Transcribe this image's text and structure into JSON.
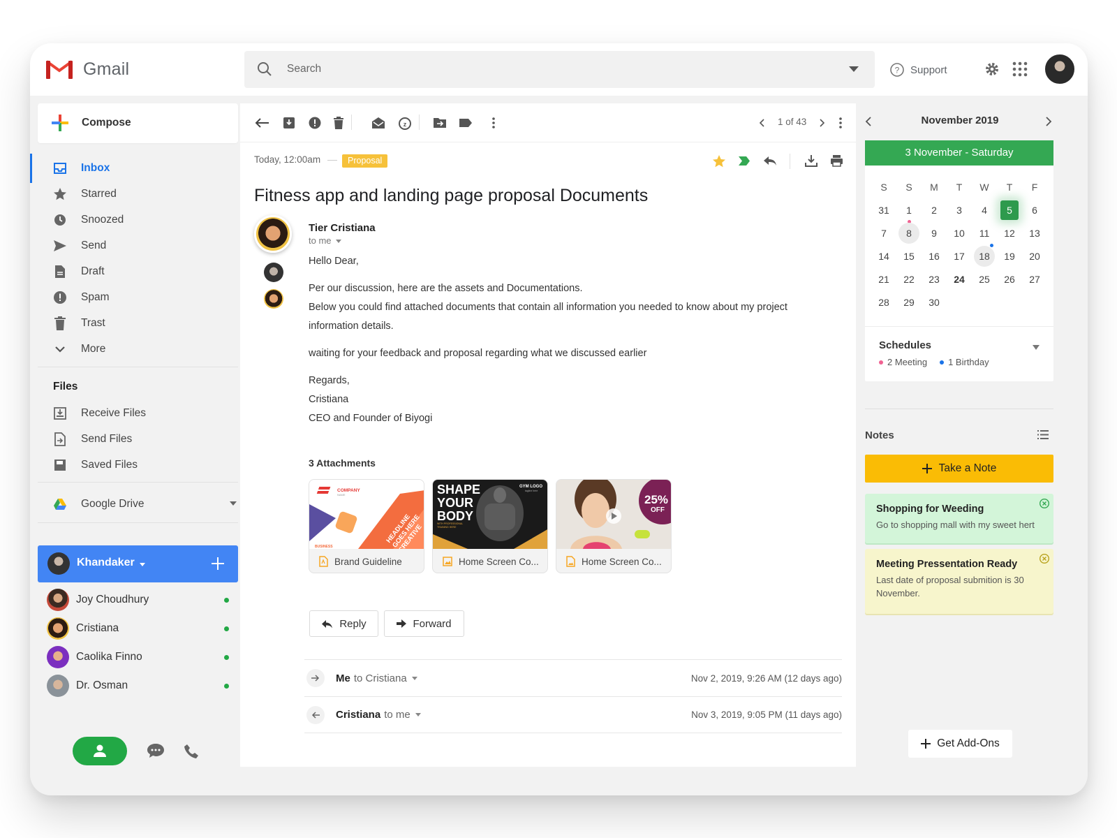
{
  "app": {
    "title": "Gmail"
  },
  "header": {
    "search_placeholder": "Search",
    "support_label": "Support"
  },
  "sidebar": {
    "compose_label": "Compose",
    "nav": [
      {
        "label": "Inbox",
        "icon": "inbox-icon",
        "active": true
      },
      {
        "label": "Starred",
        "icon": "star-icon"
      },
      {
        "label": "Snoozed",
        "icon": "clock-icon"
      },
      {
        "label": "Send",
        "icon": "send-icon"
      },
      {
        "label": "Draft",
        "icon": "draft-icon"
      },
      {
        "label": "Spam",
        "icon": "spam-icon"
      },
      {
        "label": "Trast",
        "icon": "trash-icon"
      },
      {
        "label": "More",
        "icon": "chevron-down-icon"
      }
    ],
    "files_title": "Files",
    "files": [
      {
        "label": "Receive Files",
        "icon": "receive-files-icon"
      },
      {
        "label": "Send Files",
        "icon": "send-files-icon"
      },
      {
        "label": "Saved Files",
        "icon": "saved-files-icon"
      }
    ],
    "drive_label": "Google Drive",
    "account_name": "Khandaker",
    "contacts": [
      {
        "name": "Joy Choudhury",
        "online": true
      },
      {
        "name": "Cristiana",
        "online": true
      },
      {
        "name": "Caolika Finno",
        "online": true
      },
      {
        "name": "Dr. Osman",
        "online": true
      }
    ]
  },
  "email": {
    "pager": "1 of 43",
    "date": "Today, 12:00am",
    "tag": "Proposal",
    "subject": "Fitness app and landing page proposal Documents",
    "sender": "Tier Cristiana",
    "to": "to me",
    "body": [
      "Hello Dear,",
      "Per our discussion, here are the assets and Documentations.",
      "Below you could find attached documents that contain all information you needed to know about my project",
      "information details.",
      "waiting for your feedback and proposal regarding what we discussed earlier",
      "Regards,",
      "Cristiana",
      "CEO and Founder of Biyogi"
    ],
    "attachments_title": "3 Attachments",
    "attachments": [
      {
        "name": "Brand Guideline",
        "type": "pdf",
        "thumb": {
          "t1": "COMPANY",
          "t2": "NAME",
          "t3": "BUSINESS",
          "t4": "HEADLINE",
          "t5": "GOES HERE",
          "t6": "CREATIVE"
        }
      },
      {
        "name": "Home Screen Co...",
        "type": "image",
        "thumb": {
          "l1": "SHAPE",
          "l2": "YOUR",
          "l3": "BODY",
          "logo": "GYM LOGO",
          "tagline": "tagline here",
          "sub1": "WITH PROFESSIONAL",
          "sub2": "TRAINING HERE"
        }
      },
      {
        "name": "Home Screen Co...",
        "type": "image",
        "thumb": {
          "pct": "25%",
          "off": "OFF"
        }
      }
    ],
    "reply_label": "Reply",
    "forward_label": "Forward",
    "thread": [
      {
        "who": "Me",
        "to": "to Cristiana",
        "when": "Nov 2, 2019, 9:26 AM (12 days ago)",
        "direction": "out"
      },
      {
        "who": "Cristiana",
        "to": "to me",
        "when": "Nov 3, 2019, 9:05 PM (11 days ago)",
        "direction": "in"
      }
    ]
  },
  "calendar": {
    "month": "November 2019",
    "selected": "3 November - Saturday",
    "dow": [
      "S",
      "S",
      "M",
      "T",
      "W",
      "T",
      "F"
    ],
    "weeks": [
      [
        "31",
        "1",
        "2",
        "3",
        "4",
        "5",
        "6"
      ],
      [
        "7",
        "8",
        "9",
        "10",
        "11",
        "12",
        "13"
      ],
      [
        "14",
        "15",
        "16",
        "17",
        "18",
        "19",
        "20"
      ],
      [
        "21",
        "22",
        "23",
        "24",
        "25",
        "26",
        "27"
      ],
      [
        "28",
        "29",
        "30"
      ]
    ],
    "highlight": "5",
    "schedules_title": "Schedules",
    "meetings": "2 Meeting",
    "birthdays": "1 Birthday",
    "colors": {
      "green": "#34a853",
      "meeting_dot": "#f06292",
      "birthday_dot": "#1a73e8"
    }
  },
  "notes": {
    "title": "Notes",
    "take_note_label": "Take a Note",
    "items": [
      {
        "title": "Shopping for Weeding",
        "body": "Go to shopping mall with my sweet hert",
        "color": "#d3f5d9"
      },
      {
        "title": "Meeting Pressentation Ready",
        "body": "Last date of proposal submition  is 30 November.",
        "color": "#f7f5cc"
      }
    ]
  },
  "addons_label": "Get Add-Ons",
  "colors": {
    "accent": "#1a73e8",
    "account_bar": "#4285f4",
    "online": "#22a845",
    "tag": "#f6c13a",
    "note_button": "#fabc05"
  }
}
